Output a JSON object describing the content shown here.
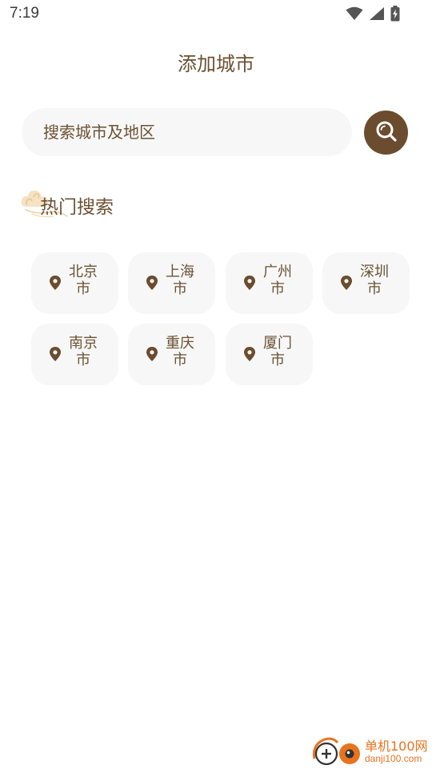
{
  "status_bar": {
    "time": "7:19",
    "icons": [
      "wifi-icon",
      "cellular-signal-icon",
      "battery-charging-icon"
    ]
  },
  "header": {
    "title": "添加城市"
  },
  "search": {
    "placeholder": "搜索城市及地区",
    "button_icon": "search-icon"
  },
  "hot_search": {
    "title": "热门搜索",
    "icon": "cloud-ornament-icon",
    "cities": [
      {
        "label": "北京市"
      },
      {
        "label": "上海市"
      },
      {
        "label": "广州市"
      },
      {
        "label": "深圳市"
      },
      {
        "label": "南京市"
      },
      {
        "label": "重庆市"
      },
      {
        "label": "厦门市"
      }
    ]
  },
  "watermark": {
    "name": "单机100网",
    "domain": "danji100.com"
  },
  "colors": {
    "primary": "#6b4c2e",
    "text": "#6b5233",
    "chip_background": "#f7f7f7",
    "watermark": "#e8731f"
  }
}
